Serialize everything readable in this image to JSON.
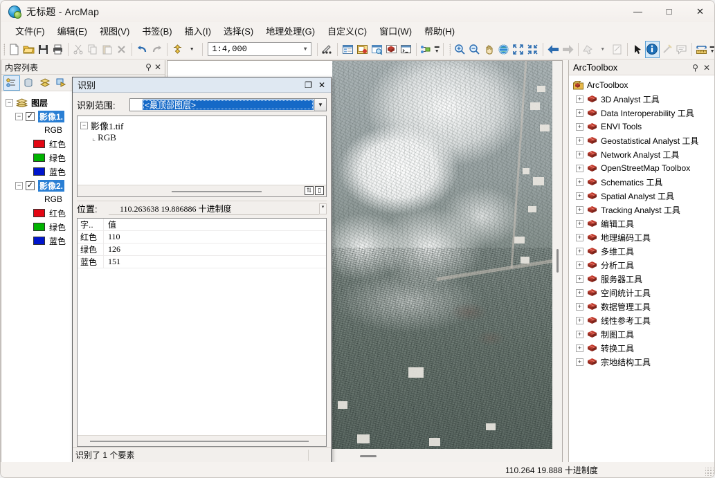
{
  "window": {
    "title": "无标题 - ArcMap",
    "app_icon": "arcmap-globe-icon",
    "minimize": "—",
    "maximize": "□",
    "close": "✕"
  },
  "menubar": {
    "items": [
      {
        "label": "文件(F)",
        "name": "menu-file"
      },
      {
        "label": "编辑(E)",
        "name": "menu-edit"
      },
      {
        "label": "视图(V)",
        "name": "menu-view"
      },
      {
        "label": "书签(B)",
        "name": "menu-bookmarks"
      },
      {
        "label": "插入(I)",
        "name": "menu-insert"
      },
      {
        "label": "选择(S)",
        "name": "menu-selection"
      },
      {
        "label": "地理处理(G)",
        "name": "menu-geoprocessing"
      },
      {
        "label": "自定义(C)",
        "name": "menu-customize"
      },
      {
        "label": "窗口(W)",
        "name": "menu-window"
      },
      {
        "label": "帮助(H)",
        "name": "menu-help"
      }
    ]
  },
  "toolbar": {
    "scale_value": "1:4,000",
    "scale_dropdown_arrow": "▼",
    "overflow_arrow": "▼",
    "buttons": [
      "new-document-icon",
      "open-document-icon",
      "save-icon",
      "print-icon",
      "cut-icon",
      "copy-icon",
      "paste-icon",
      "delete-icon",
      "undo-icon",
      "redo-icon",
      "add-data-icon",
      "editor-toolbar-icon",
      "table-of-contents-icon",
      "catalog-icon",
      "search-icon",
      "arctoolbox-icon",
      "python-window-icon",
      "modelbuilder-icon",
      "zoom-in-icon",
      "zoom-out-icon",
      "pan-icon",
      "full-extent-icon",
      "fixed-zoom-in-icon",
      "fixed-zoom-out-icon",
      "go-back-extent-icon",
      "go-next-extent-icon",
      "select-features-icon",
      "clear-selection-icon",
      "select-elements-icon",
      "identify-icon",
      "hyperlink-icon",
      "html-popup-icon",
      "measure-icon"
    ]
  },
  "toc": {
    "title": "内容列表",
    "pin_icon": "pin-icon",
    "close_icon": "close-icon",
    "toolbar_buttons": [
      "list-by-drawing-order-icon",
      "list-by-source-icon",
      "list-by-visibility-icon",
      "list-by-selection-icon"
    ],
    "tree": {
      "root": {
        "label": "图层",
        "expander": "−",
        "icon": "layers-icon"
      },
      "layers": [
        {
          "name": "影像1.",
          "expander": "−",
          "checked": true,
          "check_glyph": "✓",
          "renderer": "RGB",
          "bands": [
            {
              "label": "红色",
              "color": "#e30613"
            },
            {
              "label": "绿色",
              "color": "#00b300"
            },
            {
              "label": "蓝色",
              "color": "#0015cc"
            }
          ]
        },
        {
          "name": "影像2.",
          "expander": "−",
          "checked": true,
          "check_glyph": "✓",
          "renderer": "RGB",
          "bands": [
            {
              "label": "红色",
              "color": "#e30613"
            },
            {
              "label": "绿色",
              "color": "#00b300"
            },
            {
              "label": "蓝色",
              "color": "#0015cc"
            }
          ]
        }
      ]
    }
  },
  "identify": {
    "title": "识别",
    "maximize_glyph": "❐",
    "close_glyph": "✕",
    "scope_label": "识别范围:",
    "scope_value": "<最顶部图层>",
    "scope_arrow": "▼",
    "tree": {
      "node_expander": "−",
      "node_label": "影像1.tif",
      "child_label": "RGB"
    },
    "tree_buttons": [
      "sort-az-button",
      "column-button"
    ],
    "location_label": "位置:",
    "location_value": "110.263638  19.886886",
    "location_units": "十进制度",
    "attribute_table": {
      "headers": [
        "字..",
        "值"
      ],
      "rows": [
        {
          "field": "红色",
          "value": "110"
        },
        {
          "field": "绿色",
          "value": "126"
        },
        {
          "field": "蓝色",
          "value": "151"
        }
      ]
    },
    "status": "识别了 1 个要素"
  },
  "arctoolbox": {
    "title": "ArcToolbox",
    "pin_icon": "pin-icon",
    "close_icon": "close-icon",
    "root_label": "ArcToolbox",
    "root_icon": "arctoolbox-root-icon",
    "expander_glyph": "+",
    "items": [
      {
        "label": "3D Analyst 工具"
      },
      {
        "label": "Data Interoperability 工具"
      },
      {
        "label": "ENVI Tools"
      },
      {
        "label": "Geostatistical Analyst 工具"
      },
      {
        "label": "Network Analyst 工具"
      },
      {
        "label": "OpenStreetMap Toolbox"
      },
      {
        "label": "Schematics 工具"
      },
      {
        "label": "Spatial Analyst 工具"
      },
      {
        "label": "Tracking Analyst 工具"
      },
      {
        "label": "编辑工具"
      },
      {
        "label": "地理编码工具"
      },
      {
        "label": "多维工具"
      },
      {
        "label": "分析工具"
      },
      {
        "label": "服务器工具"
      },
      {
        "label": "空间统计工具"
      },
      {
        "label": "数据管理工具"
      },
      {
        "label": "线性参考工具"
      },
      {
        "label": "制图工具"
      },
      {
        "label": "转换工具"
      },
      {
        "label": "宗地结构工具"
      }
    ]
  },
  "statusbar": {
    "coordinates": "110.264  19.888",
    "units": "十进制度"
  },
  "colors": {
    "selection_blue": "#2a7fd4",
    "combo_highlight": "#1569c7",
    "dialog_title_bg": "#dfe8f2",
    "panel_bg": "#f2efec",
    "toolbox_red": "#b5453a"
  }
}
